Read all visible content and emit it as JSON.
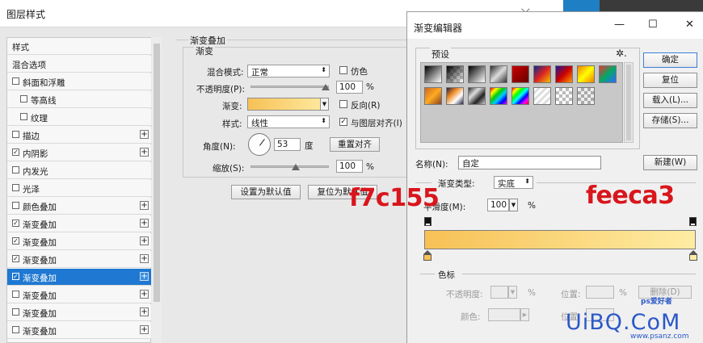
{
  "layer_style": {
    "title": "图层样式",
    "styles_list": [
      {
        "label": "样式",
        "has_checkbox": false,
        "checked": false,
        "has_plus": false,
        "selected": false
      },
      {
        "label": "混合选项",
        "has_checkbox": false,
        "checked": false,
        "has_plus": false,
        "selected": false
      },
      {
        "label": "斜面和浮雕",
        "has_checkbox": true,
        "checked": false,
        "has_plus": false,
        "selected": false
      },
      {
        "label": "等高线",
        "has_checkbox": true,
        "checked": false,
        "has_plus": false,
        "selected": false,
        "indent": true
      },
      {
        "label": "纹理",
        "has_checkbox": true,
        "checked": false,
        "has_plus": false,
        "selected": false,
        "indent": true
      },
      {
        "label": "描边",
        "has_checkbox": true,
        "checked": false,
        "has_plus": true,
        "selected": false
      },
      {
        "label": "内阴影",
        "has_checkbox": true,
        "checked": true,
        "has_plus": true,
        "selected": false
      },
      {
        "label": "内发光",
        "has_checkbox": true,
        "checked": false,
        "has_plus": false,
        "selected": false
      },
      {
        "label": "光泽",
        "has_checkbox": true,
        "checked": false,
        "has_plus": false,
        "selected": false
      },
      {
        "label": "颜色叠加",
        "has_checkbox": true,
        "checked": false,
        "has_plus": true,
        "selected": false
      },
      {
        "label": "渐变叠加",
        "has_checkbox": true,
        "checked": true,
        "has_plus": true,
        "selected": false
      },
      {
        "label": "渐变叠加",
        "has_checkbox": true,
        "checked": true,
        "has_plus": true,
        "selected": false
      },
      {
        "label": "渐变叠加",
        "has_checkbox": true,
        "checked": true,
        "has_plus": true,
        "selected": false
      },
      {
        "label": "渐变叠加",
        "has_checkbox": true,
        "checked": true,
        "has_plus": true,
        "selected": true
      },
      {
        "label": "渐变叠加",
        "has_checkbox": true,
        "checked": false,
        "has_plus": true,
        "selected": false
      },
      {
        "label": "渐变叠加",
        "has_checkbox": true,
        "checked": false,
        "has_plus": true,
        "selected": false
      },
      {
        "label": "渐变叠加",
        "has_checkbox": true,
        "checked": false,
        "has_plus": true,
        "selected": false
      }
    ],
    "gradient_overlay": {
      "section_title": "渐变叠加",
      "sub_title": "渐变",
      "blend_mode_label": "混合模式:",
      "blend_mode_value": "正常",
      "dither_label": "仿色",
      "opacity_label": "不透明度(P):",
      "opacity_value": "100",
      "opacity_unit": "%",
      "gradient_label": "渐变:",
      "reverse_label": "反向(R)",
      "style_label": "样式:",
      "style_value": "线性",
      "align_label": "与图层对齐(I)",
      "angle_label": "角度(N):",
      "angle_value": "53",
      "angle_unit": "度",
      "reset_align_label": "重置对齐",
      "scale_label": "缩放(S):",
      "scale_value": "100",
      "scale_unit": "%",
      "set_default_label": "设置为默认值",
      "reset_default_label": "复位为默认值"
    }
  },
  "gradient_editor": {
    "title": "渐变编辑器",
    "minimize_glyph": "—",
    "maximize_glyph": "☐",
    "close_glyph": "✕",
    "presets_title": "预设",
    "gear_glyph": "✲.",
    "buttons": {
      "ok": "确定",
      "reset": "复位",
      "load": "载入(L)...",
      "save": "存储(S)...",
      "new": "新建(W)"
    },
    "name_label": "名称(N):",
    "name_value": "自定",
    "gradient_type_label": "渐变类型:",
    "gradient_type_value": "实底",
    "smoothness_label": "平滑度(M):",
    "smoothness_value": "100",
    "smoothness_unit": "%",
    "color_stops_title": "色标",
    "stop_opacity_label": "不透明度:",
    "stop_opacity_unit": "%",
    "location_label": "位置:",
    "location_unit": "%",
    "delete_label": "删除(D)",
    "color_label": "颜色:",
    "location2_label": "位置:"
  },
  "gradient": {
    "start_color": "#f7c155",
    "end_color": "#feeca3"
  },
  "annotations": {
    "left_hex": "f7c155",
    "right_hex": "feeca3"
  },
  "colors": {
    "selection": "#1f78d1",
    "annotation_red": "#d8161c",
    "watermark_blue": "#2b58c9"
  },
  "watermark": {
    "main": "UiBQ.CoM",
    "sub": "www.psanz.com",
    "logo": "ps爱好者"
  }
}
